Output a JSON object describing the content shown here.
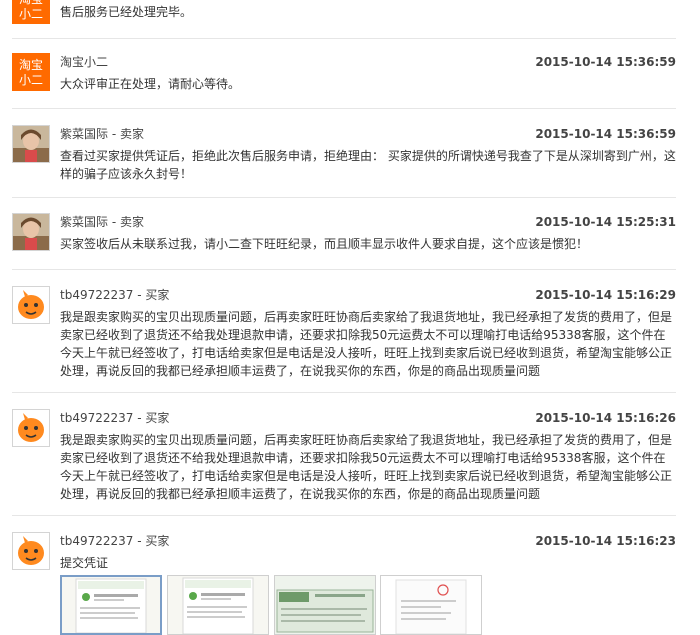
{
  "messages": [
    {
      "avatar": "xiaoer-logo",
      "body": "售后服务已经处理完毕。"
    },
    {
      "sender": "淘宝小二",
      "avatar": "xiaoer-logo",
      "time": "2015-10-14 15:36:59",
      "body": "大众评审正在处理，请耐心等待。"
    },
    {
      "sender": "紫菜国际 - 卖家",
      "avatar": "photo-avatar",
      "time": "2015-10-14 15:36:59",
      "body": "查看过买家提供凭证后，拒绝此次售后服务申请，拒绝理由： 买家提供的所谓快递号我查了下是从深圳寄到广州，这样的骗子应该永久封号！"
    },
    {
      "sender": "紫菜国际 - 卖家",
      "avatar": "photo-avatar",
      "time": "2015-10-14 15:25:31",
      "body": "买家签收后从未联系过我，请小二查下旺旺纪录，而且顺丰显示收件人要求自提，这个应该是惯犯！"
    },
    {
      "sender": "tb49722237 - 买家",
      "avatar": "buyer-cartoon-avatar",
      "time": "2015-10-14 15:16:29",
      "body": "我是跟卖家购买的宝贝出现质量问题，后再卖家旺旺协商后卖家给了我退货地址，我已经承担了发货的费用了，但是卖家已经收到了退货还不给我处理退款申请，还要求扣除我50元运费太不可以理喻打电话给95338客服，这个件在今天上午就已经签收了，打电话给卖家但是电话是没人接听，旺旺上找到卖家后说已经收到退货，希望淘宝能够公正处理，再说反回的我都已经承担顺丰运费了，在说我买你的东西，你是的商品出现质量问题"
    },
    {
      "sender": "tb49722237 - 买家",
      "avatar": "buyer-cartoon-avatar",
      "time": "2015-10-14 15:16:26",
      "body": "我是跟卖家购买的宝贝出现质量问题，后再卖家旺旺协商后卖家给了我退货地址，我已经承担了发货的费用了，但是卖家已经收到了退货还不给我处理退款申请，还要求扣除我50元运费太不可以理喻打电话给95338客服，这个件在今天上午就已经签收了，打电话给卖家但是电话是没人接听，旺旺上找到卖家后说已经收到退货，希望淘宝能够公正处理，再说反回的我都已经承担顺丰运费了，在说我买你的东西，你是的商品出现质量问题"
    },
    {
      "sender": "tb49722237 - 买家",
      "avatar": "buyer-cartoon-avatar",
      "time": "2015-10-14 15:16:23",
      "body": "提交凭证"
    }
  ],
  "xiaoer_logo_lines": [
    "淘宝",
    "小二"
  ],
  "thumbnails": [
    "app-screenshot-1",
    "app-screenshot-2",
    "shipping-receipt",
    "document-scan"
  ],
  "colors": {
    "xiaoer_orange": "#ff6a00",
    "divider": "#e6e6e6",
    "thumb_selected_border": "#7a9dc7"
  }
}
